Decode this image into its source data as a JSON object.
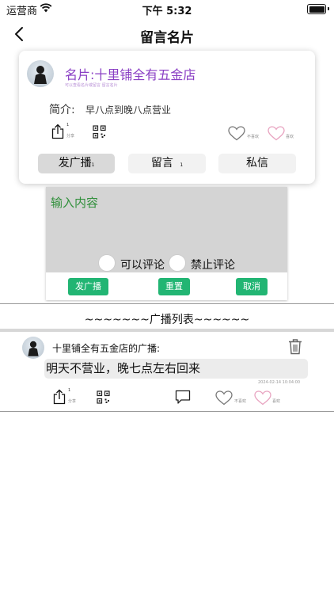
{
  "status_bar": {
    "carrier": "运营商",
    "time": "下午 5:32"
  },
  "nav": {
    "title": "留言名片"
  },
  "card": {
    "name": "名片:十里铺全有五金店",
    "faint_text": "可以查看名片或留言 留言名片",
    "intro_label": "简介:",
    "intro_value": "早八点到晚八点营业",
    "share_label": "分享",
    "unlike_label": "不喜欢",
    "like_label": "喜欢",
    "tabs": [
      {
        "label": "发广播"
      },
      {
        "label": "留言"
      },
      {
        "label": "私信"
      }
    ],
    "tab_badge": "1"
  },
  "input_panel": {
    "placeholder": "输入内容",
    "allow_comment": "可以评论",
    "forbid_comment": "禁止评论",
    "buttons": {
      "publish": "发广播",
      "reset": "重置",
      "cancel": "取消"
    }
  },
  "list": {
    "title": "~~~~~~~广播列表~~~~~~",
    "items": [
      {
        "author": "十里铺全有五金店的广播:",
        "message": "明天不营业，晚七点左右回来",
        "timestamp": "2024-02-14 10:04:00",
        "share_label": "分享",
        "unlike_label": "不喜欢",
        "like_label": "喜欢"
      }
    ]
  },
  "colors": {
    "accent_purple": "#8a3fc4",
    "green_button": "#22b573",
    "green_text": "#2f8f3a",
    "like_pink": "#e8a3c0"
  },
  "icons": [
    "back-chevron-icon",
    "share-icon",
    "qrcode-icon",
    "heart-outline-icon",
    "heart-pink-icon",
    "trash-icon",
    "comment-icon",
    "wifi-icon",
    "battery-icon"
  ]
}
